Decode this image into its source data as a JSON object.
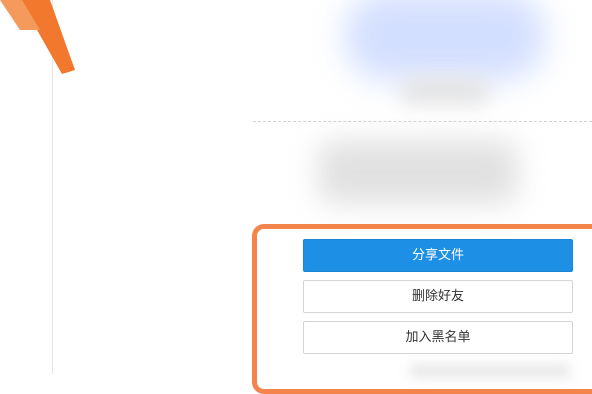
{
  "actions": {
    "share_file": "分享文件",
    "delete_friend": "删除好友",
    "add_blacklist": "加入黑名单"
  },
  "colors": {
    "primary_button": "#1d8fe5",
    "highlight_annotation": "#f3844c"
  },
  "icons": {
    "annotation_arrow": "arrow-pointer-icon"
  }
}
